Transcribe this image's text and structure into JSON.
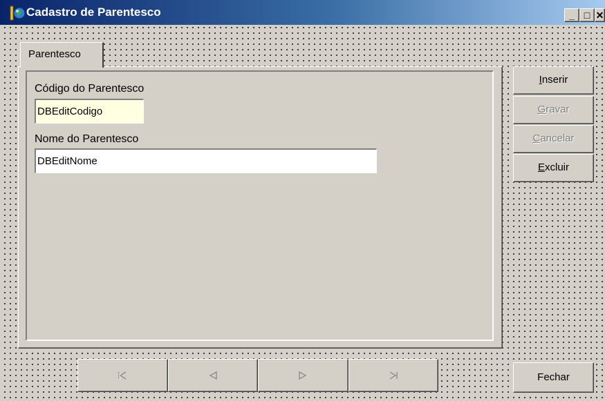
{
  "window": {
    "title": "Cadastro de Parentesco",
    "controls": {
      "minimize": "_",
      "maximize": "□",
      "close": "✕"
    }
  },
  "tabs": [
    {
      "label": "Parentesco",
      "active": true
    }
  ],
  "form": {
    "codigo": {
      "label": "Código do Parentesco",
      "value": "DBEditCodigo"
    },
    "nome": {
      "label": "Nome do Parentesco",
      "value": "DBEditNome"
    }
  },
  "actions": [
    {
      "label_pre": "",
      "label_accel": "I",
      "label_post": "nserir",
      "enabled": true
    },
    {
      "label_pre": "",
      "label_accel": "G",
      "label_post": "ravar",
      "enabled": false
    },
    {
      "label_pre": "",
      "label_accel": "C",
      "label_post": "ancelar",
      "enabled": false
    },
    {
      "label_pre": "",
      "label_accel": "E",
      "label_post": "xcluir",
      "enabled": true
    }
  ],
  "navigator": {
    "buttons": [
      "first-record",
      "prior-record",
      "next-record",
      "last-record"
    ],
    "enabled": false
  },
  "close_button": {
    "label": "Fechar"
  },
  "colors": {
    "title_gradient_start": "#0a246a",
    "title_gradient_end": "#a6caf0",
    "face": "#d4d0c8",
    "codigo_field_bg": "#ffffe1",
    "disabled_text": "#808080"
  }
}
